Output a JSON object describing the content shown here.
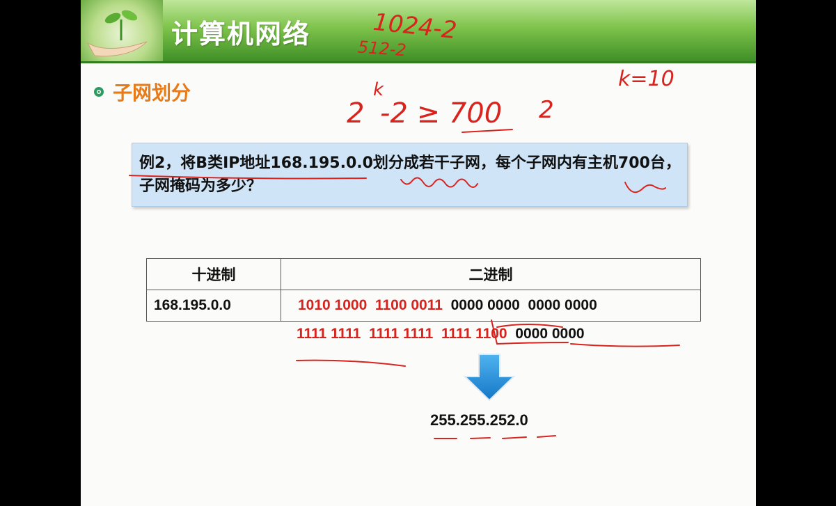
{
  "header": {
    "title": "计算机网络"
  },
  "section": {
    "title": "子网划分"
  },
  "problem": {
    "text": "例2，将B类IP地址168.195.0.0划分成若干子网，每个子网内有主机700台，子网掩码为多少？"
  },
  "table": {
    "headers": [
      "十进制",
      "二进制"
    ],
    "decimal": "168.195.0.0",
    "binary_red": "1010 1000  1100 0011",
    "binary_black": "0000 0000  0000 0000"
  },
  "mask": {
    "red": "1111 1111  1111 1111  1111 1100",
    "black": "0000 0000"
  },
  "result": "255.255.252.0",
  "annotations": {
    "top1": "1024-2",
    "top2": "512-2",
    "right": "k=10",
    "eq_base": "2",
    "eq_exp": "k",
    "eq_rest": "-2 ≥ 700",
    "eq_two": "2"
  },
  "colors": {
    "header_green": "#3f8f27",
    "accent_orange": "#e87a17",
    "ink_red": "#d9231e",
    "box_blue": "#cfe4f6",
    "arrow_blue": "#1e8fdc"
  }
}
